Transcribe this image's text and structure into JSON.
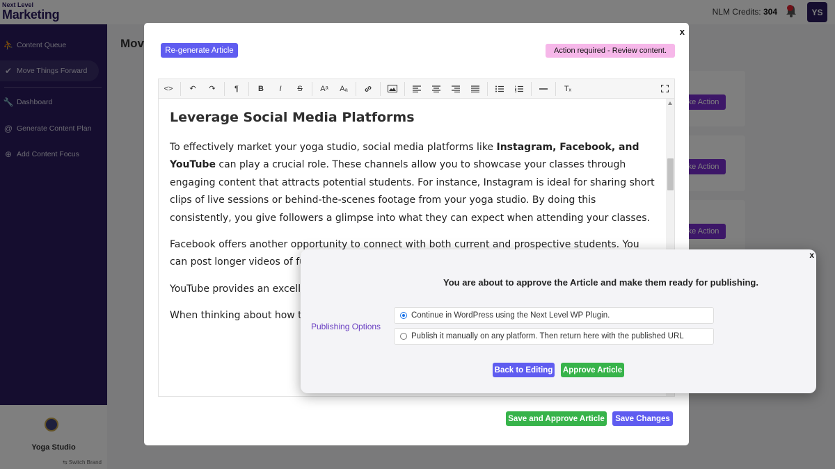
{
  "header": {
    "logo_small": "Next Level",
    "logo_big": "Marketing",
    "credits_label": "NLM Credits:",
    "credits_value": "304",
    "avatar_initials": "YS"
  },
  "sidebar": {
    "items": [
      {
        "label": "Content Queue",
        "icon": "hiking-icon"
      },
      {
        "label": "Move Things Forward",
        "icon": "checkmark-icon"
      },
      {
        "label": "Dashboard",
        "icon": "wrench-icon"
      },
      {
        "label": "Generate Content Plan",
        "icon": "at-sign-icon"
      },
      {
        "label": "Add Content Focus",
        "icon": "search-plus-icon"
      }
    ],
    "brand_name": "Yoga Studio",
    "switch_brand": "⇆ Switch Brand"
  },
  "main": {
    "page_title": "Mov",
    "take_action_label": "ke Action"
  },
  "editor_modal": {
    "close_label": "x",
    "regenerate_label": "Re-generate Article",
    "status_badge": "Action required - Review content.",
    "toolbar": {
      "code": "<>",
      "undo": "↶",
      "redo": "↷",
      "paragraph": "¶",
      "bold": "B",
      "italic": "I",
      "strike": "S",
      "superscript": "Aᵃ",
      "subscript": "Aₐ",
      "link": "🔗",
      "image": "▣",
      "clear_format": "Tₓ",
      "fullscreen": "⛶"
    },
    "content": {
      "heading": "Leverage Social Media Platforms",
      "p1_before": "To effectively market your yoga studio, social media platforms like ",
      "p1_bold": "Instagram, Facebook, and YouTube",
      "p1_after": " can play a crucial role. These channels allow you to showcase your classes through engaging content that attracts potential students. For instance, Instagram is ideal for sharing short clips of live sessions or behind-the-scenes footage from your yoga studio. By doing this consistently, you give followers a glimpse into what they can expect when attending your classes.",
      "p2": "Facebook offers another opportunity to connect with both current and prospective students. You can post longer videos of full yoga rou experience at your studio. Th who follow you online.",
      "p3": "YouTube provides an exceller meditation sessions. These lo valuable resources for peopl",
      "p4": "When thinking about how to"
    },
    "save_approve_label": "Save and Approve Article",
    "save_changes_label": "Save Changes"
  },
  "approve_dialog": {
    "close_label": "x",
    "title": "You are about to approve the Article and make them ready for publishing.",
    "publishing_label": "Publishing Options",
    "options": [
      {
        "label": "Continue in WordPress using the Next Level WP Plugin.",
        "checked": true
      },
      {
        "label": "Publish it manually on any platform. Then return here with the published URL",
        "checked": false
      }
    ],
    "back_label": "Back to Editing",
    "approve_label": "Approve Article"
  }
}
